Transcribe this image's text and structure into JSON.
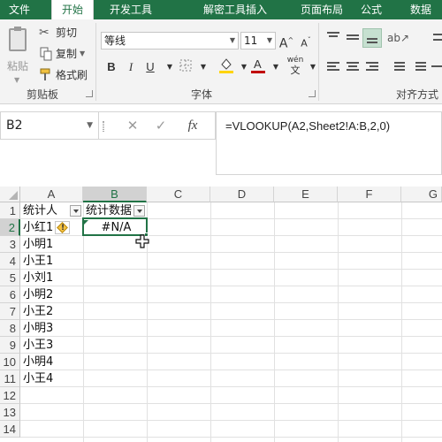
{
  "tabs": [
    "文件",
    "开始",
    "开发工具",
    "解密工具",
    "插入",
    "页面布局",
    "公式",
    "数据"
  ],
  "active_tab_index": 1,
  "clipboard": {
    "paste_label": "粘贴",
    "cut_label": "剪切",
    "copy_label": "复制",
    "format_painter_label": "格式刷",
    "group_label": "剪贴板"
  },
  "font": {
    "font_name": "等线",
    "font_size": "11",
    "group_label": "字体",
    "bold": "B",
    "italic": "I",
    "underline": "U",
    "pinyin": "wén",
    "grow": "A",
    "shrink": "A"
  },
  "alignment": {
    "group_label": "对齐方式"
  },
  "name_box": "B2",
  "formula_bar": {
    "fx_label": "fx",
    "formula": "=VLOOKUP(A2,Sheet2!A:B,2,0)"
  },
  "columns": [
    "A",
    "B",
    "C",
    "D",
    "E",
    "F",
    "G"
  ],
  "selected_column": "B",
  "rows": [
    "1",
    "2",
    "3",
    "4",
    "5",
    "6",
    "7",
    "8",
    "9",
    "10",
    "11",
    "12",
    "13",
    "14"
  ],
  "selected_row": "2",
  "cells": {
    "A1": "统计人",
    "B1": "统计数据",
    "A2": "小红1",
    "B2": "#N/A",
    "A3": "小明1",
    "A4": "小王1",
    "A5": "小刘1",
    "A6": "小明2",
    "A7": "小王2",
    "A8": "小明3",
    "A9": "小王3",
    "A10": "小明4",
    "A11": "小王4"
  },
  "colors": {
    "accent": "#217346",
    "font_color_bar": "#c00000",
    "fill_color_bar": "#ffd400",
    "warning": "#f5c242"
  },
  "icons": [
    "cut-icon",
    "copy-icon",
    "format-painter-icon",
    "paste-icon",
    "warning-icon",
    "fill-color-icon",
    "font-color-icon",
    "borders-icon",
    "cancel-icon",
    "enter-icon",
    "cursor-icon"
  ]
}
